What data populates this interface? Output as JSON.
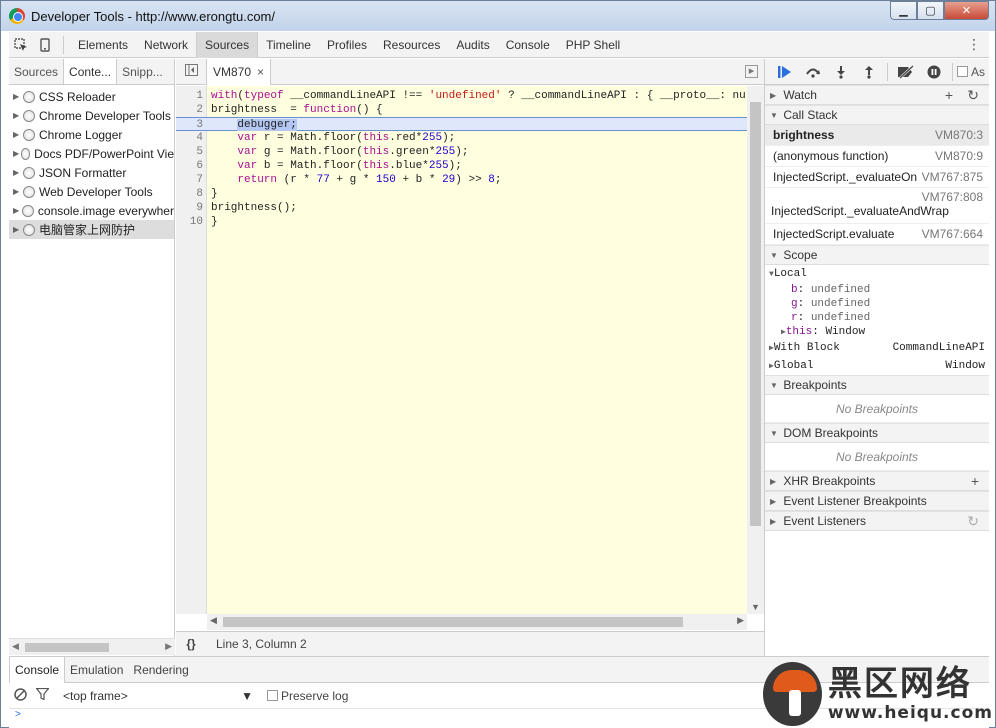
{
  "window": {
    "title": "Developer Tools - http://www.erongtu.com/",
    "min": "▁",
    "max": "▢",
    "close": "✕"
  },
  "toolbar": {
    "inspect_icon": "inspect-element-icon",
    "device_icon": "device-mode-icon",
    "tabs": [
      "Elements",
      "Network",
      "Sources",
      "Timeline",
      "Profiles",
      "Resources",
      "Audits",
      "Console",
      "PHP Shell"
    ],
    "selected": "Sources",
    "more": "⋮"
  },
  "navigator": {
    "tabs": [
      "Sources",
      "Conte...",
      "Snipp..."
    ],
    "selected": "Conte...",
    "items": [
      "CSS Reloader",
      "Chrome Developer Tools",
      "Chrome Logger",
      "Docs PDF/PowerPoint Vie",
      "JSON Formatter",
      "Web Developer Tools",
      "console.image everywher",
      "电脑管家上网防护"
    ]
  },
  "editor": {
    "tab": "VM870",
    "close": "×",
    "status": "Line 3, Column 2",
    "pretty": "{}",
    "lines": [
      {
        "n": "1",
        "segs": [
          [
            "kw",
            "with"
          ],
          [
            "",
            "("
          ],
          [
            "kw",
            "typeof"
          ],
          [
            "",
            " __commandLineAPI !== "
          ],
          [
            "st",
            "'undefined'"
          ],
          [
            "",
            " ? __commandLineAPI : { __proto__: nu"
          ]
        ]
      },
      {
        "n": "2",
        "segs": [
          [
            "",
            "brightness  = "
          ],
          [
            "kw",
            "function"
          ],
          [
            "",
            "() {"
          ]
        ]
      },
      {
        "n": "3",
        "segs": [
          [
            "",
            "    "
          ],
          [
            "dbg",
            "debugger;"
          ],
          [
            "",
            "    "
          ]
        ]
      },
      {
        "n": "4",
        "segs": [
          [
            "",
            "    "
          ],
          [
            "kw",
            "var"
          ],
          [
            "",
            " r = Math.floor("
          ],
          [
            "kw",
            "this"
          ],
          [
            "",
            ".red*"
          ],
          [
            "nu",
            "255"
          ],
          [
            "",
            ");"
          ]
        ]
      },
      {
        "n": "5",
        "segs": [
          [
            "",
            "    "
          ],
          [
            "kw",
            "var"
          ],
          [
            "",
            " g = Math.floor("
          ],
          [
            "kw",
            "this"
          ],
          [
            "",
            ".green*"
          ],
          [
            "nu",
            "255"
          ],
          [
            "",
            ");"
          ]
        ]
      },
      {
        "n": "6",
        "segs": [
          [
            "",
            "    "
          ],
          [
            "kw",
            "var"
          ],
          [
            "",
            " b = Math.floor("
          ],
          [
            "kw",
            "this"
          ],
          [
            "",
            ".blue*"
          ],
          [
            "nu",
            "255"
          ],
          [
            "",
            ");"
          ]
        ]
      },
      {
        "n": "7",
        "segs": [
          [
            "",
            "    "
          ],
          [
            "kw",
            "return"
          ],
          [
            "",
            " (r * "
          ],
          [
            "nu",
            "77"
          ],
          [
            "",
            " + g * "
          ],
          [
            "nu",
            "150"
          ],
          [
            "",
            " + b * "
          ],
          [
            "nu",
            "29"
          ],
          [
            "",
            ") >> "
          ],
          [
            "nu",
            "8"
          ],
          [
            "",
            ";"
          ]
        ]
      },
      {
        "n": "8",
        "segs": [
          [
            "",
            "}"
          ]
        ]
      },
      {
        "n": "9",
        "segs": [
          [
            "",
            "brightness();"
          ]
        ]
      },
      {
        "n": "10",
        "segs": [
          [
            "",
            "}"
          ]
        ]
      }
    ]
  },
  "debugger": {
    "async_label": "As",
    "watch": "Watch",
    "callstack": "Call Stack",
    "frames": [
      {
        "fn": "brightness",
        "loc": "VM870:3"
      },
      {
        "fn": "(anonymous function)",
        "loc": "VM870:9"
      },
      {
        "fn": "InjectedScript._evaluateOn",
        "loc": "VM767:875"
      },
      {
        "fn": "InjectedScript._evaluateAndWrap",
        "loc": "VM767:808"
      },
      {
        "fn": "InjectedScript.evaluate",
        "loc": "VM767:664"
      }
    ],
    "scope": "Scope",
    "local": "Local",
    "locals": [
      {
        "name": "b",
        "value": "undefined"
      },
      {
        "name": "g",
        "value": "undefined"
      },
      {
        "name": "r",
        "value": "undefined"
      }
    ],
    "this_name": "this",
    "this_value": "Window",
    "with_block": "With Block",
    "with_value": "CommandLineAPI",
    "global": "Global",
    "global_value": "Window",
    "breakpoints": "Breakpoints",
    "no_breakpoints": "No Breakpoints",
    "dom_breakpoints": "DOM Breakpoints",
    "no_dom_breakpoints": "No Breakpoints",
    "xhr_breakpoints": "XHR Breakpoints",
    "event_listener_breakpoints": "Event Listener Breakpoints",
    "event_listeners": "Event Listeners"
  },
  "drawer": {
    "tabs": [
      "Console",
      "Emulation",
      "Rendering"
    ],
    "selected": "Console",
    "frame": "<top frame>",
    "frame_arrow": "▼",
    "preserve_log": "Preserve log",
    "prompt": ">"
  },
  "watermark": {
    "text": "黑区网络",
    "url": "www.heiqu.com"
  }
}
